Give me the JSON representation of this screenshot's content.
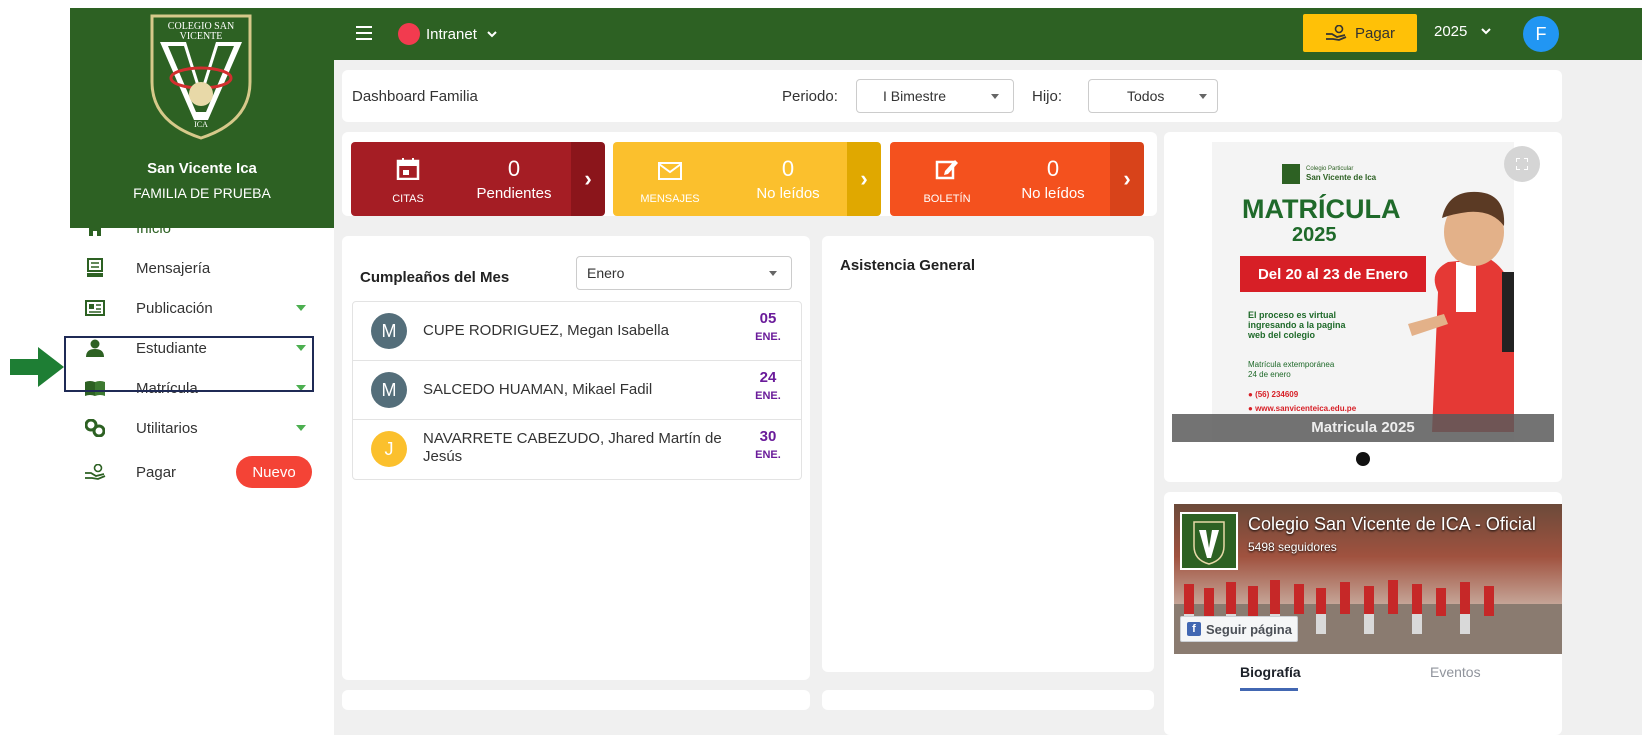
{
  "sidebar": {
    "crest_text": "COLEGIO SAN VICENTE",
    "crest_sub": "ICA",
    "school_name": "San Vicente Ica",
    "family_name": "FAMILIA DE PRUEBA",
    "items": [
      {
        "label": "Inicio",
        "icon": "home-icon",
        "active": true
      },
      {
        "label": "Mensajería",
        "icon": "message-icon"
      },
      {
        "label": "Publicación",
        "icon": "newspaper-icon",
        "has_submenu": true
      },
      {
        "label": "Estudiante",
        "icon": "student-icon",
        "has_submenu": true
      },
      {
        "label": "Matrícula",
        "icon": "book-icon",
        "has_submenu": true
      },
      {
        "label": "Utilitarios",
        "icon": "tools-icon",
        "has_submenu": true
      },
      {
        "label": "Pagar",
        "icon": "payment-icon",
        "badge": "Nuevo"
      }
    ]
  },
  "topbar": {
    "module": "Intranet",
    "pay_label": "Pagar",
    "year": "2025",
    "user_initial": "F"
  },
  "header": {
    "title": "Dashboard Familia",
    "period_label": "Periodo:",
    "period_value": "I Bimestre",
    "child_label": "Hijo:",
    "child_value": "Todos"
  },
  "tiles": [
    {
      "name": "CITAS",
      "count": "0",
      "sub": "Pendientes",
      "color": "#a51d24",
      "arrow_color": "#8b151b"
    },
    {
      "name": "MENSAJES",
      "count": "0",
      "sub": "No leídos",
      "color": "#fbc02d",
      "arrow_color": "#e0a800"
    },
    {
      "name": "BOLETÍN",
      "count": "0",
      "sub": "No leídos",
      "color": "#f4511e",
      "arrow_color": "#d8431a"
    }
  ],
  "birthdays": {
    "title": "Cumpleaños del Mes",
    "month": "Enero",
    "rows": [
      {
        "initial": "M",
        "name": "CUPE RODRIGUEZ, Megan Isabella",
        "day": "05",
        "month": "ENE.",
        "avatar_color": "#546e7a"
      },
      {
        "initial": "M",
        "name": "SALCEDO HUAMAN, Mikael Fadil",
        "day": "24",
        "month": "ENE.",
        "avatar_color": "#546e7a"
      },
      {
        "initial": "J",
        "name": "NAVARRETE CABEZUDO, Jhared Martín de Jesús",
        "day": "30",
        "month": "ENE.",
        "avatar_color": "#fbc02d"
      }
    ]
  },
  "attendance": {
    "title": "Asistencia General"
  },
  "promo": {
    "school_small": "Colegio Particular",
    "school_name": "San Vicente de Ica",
    "headline": "MATRÍCULA",
    "year": "2025",
    "dates": "Del 20 al 23 de Enero",
    "line1": "El proceso es virtual ingresando a la pagina web del colegio",
    "line2": "Matrícula extemporánea",
    "line3": "24 de enero",
    "phone": "(56) 234609",
    "web": "www.sanvicenteica.edu.pe",
    "caption": "Matricula 2025"
  },
  "facebook": {
    "page_name": "Colegio San Vicente de ICA - Oficial",
    "followers": "5498 seguidores",
    "follow_btn": "Seguir página",
    "tab_bio": "Biografía",
    "tab_events": "Eventos"
  },
  "colors": {
    "brand_green": "#2d6123",
    "accent_yellow": "#ffc107",
    "badge_red": "#f44336"
  }
}
